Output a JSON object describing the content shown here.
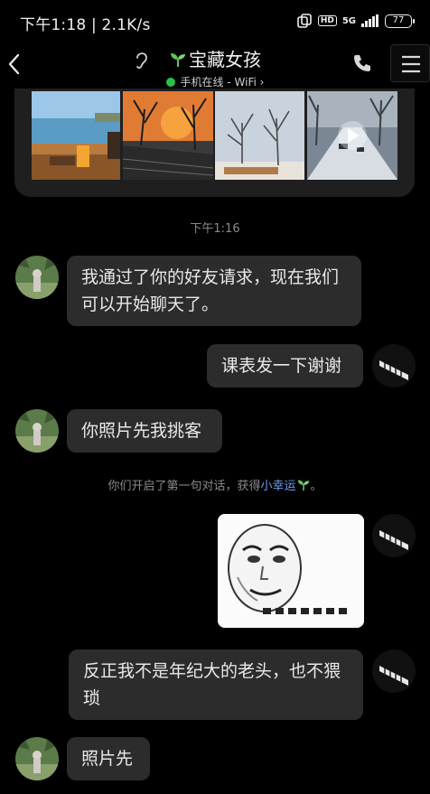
{
  "status_bar": {
    "time": "下午1:18",
    "speed": "2.1K/s",
    "network": "5G",
    "battery": "77"
  },
  "header": {
    "title": "宝藏女孩",
    "status": "手机在线 - WiFi"
  },
  "chat": {
    "timestamp": "下午1:16",
    "messages": [
      {
        "side": "left",
        "text": "我通过了你的好友请求，现在我们可以开始聊天了。"
      },
      {
        "side": "right",
        "text": "课表发一下谢谢"
      },
      {
        "side": "left",
        "text": "你照片先我挑客"
      },
      {
        "side": "right",
        "text": "反正我不是年纪大的老头，也不猥琐"
      },
      {
        "side": "left",
        "text": "照片先"
      }
    ],
    "system_note": {
      "prefix": "你们开启了第一句对话，获得",
      "link": "小幸运",
      "suffix": "。"
    }
  },
  "colors": {
    "background": "#000000",
    "bubble": "#2c2c2c",
    "online": "#27c24c",
    "link": "#6f9ff6"
  }
}
